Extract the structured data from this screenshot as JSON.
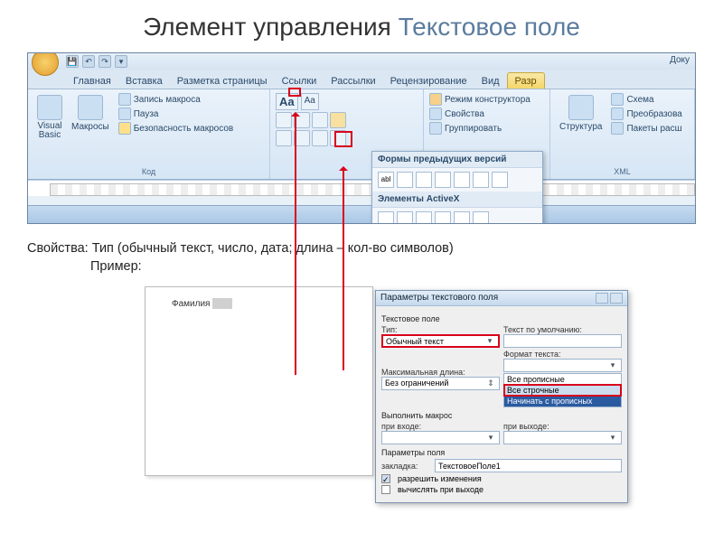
{
  "slide": {
    "title_plain": "Элемент управления ",
    "title_accent": "Текстовое поле"
  },
  "word": {
    "right_title": "Доку",
    "tabs": [
      "Главная",
      "Вставка",
      "Разметка страницы",
      "Ссылки",
      "Рассылки",
      "Рецензирование",
      "Вид",
      "Разр"
    ],
    "active_tab_index": 7,
    "groups": {
      "code": {
        "vb": "Visual\nBasic",
        "macros": "Макросы",
        "record": "Запись макроса",
        "pause": "Пауза",
        "security": "Безопасность макросов",
        "label": "Код"
      },
      "controls": {
        "aa_big": "Aa",
        "aa_small": "Aa",
        "design_mode": "Режим конструктора",
        "properties": "Свойства",
        "group": "Группировать"
      },
      "structure": {
        "btn": "Структура",
        "schema": "Схема",
        "transform": "Преобразова",
        "packages": "Пакеты расш",
        "label": "XML"
      }
    },
    "dropdown": {
      "hdr1": "Формы предыдущих версий",
      "items1": [
        "abl",
        "✓",
        "▭",
        "▦",
        "a̲",
        "◧",
        "▢"
      ],
      "hdr2": "Элементы ActiveX"
    }
  },
  "body": {
    "line1": "Свойства: Тип (обычный текст, число, дата; длина – кол-во символов)",
    "line2": "Пример:"
  },
  "doc": {
    "field_label": "Фамилия"
  },
  "dialog": {
    "title": "Параметры текстового поля",
    "section_field": "Текстовое поле",
    "type_label": "Тип:",
    "type_value": "Обычный текст",
    "default_label": "Текст по умолчанию:",
    "default_value": "",
    "maxlen_label": "Максимальная длина:",
    "maxlen_value": "Без ограничений",
    "format_label": "Формат текста:",
    "format_options": [
      "",
      "Все прописные",
      "Все строчные",
      "Начинать с прописных"
    ],
    "format_selected": "Начинать с прописных",
    "section_macro": "Выполнить макрос",
    "on_enter": "при входе:",
    "on_exit": "при выходе:",
    "section_params": "Параметры поля",
    "bookmark_label": "закладка:",
    "bookmark_value": "ТекстовоеПоле1",
    "allow_edit": "разрешить изменения",
    "calc_exit": "вычислять при выходе"
  }
}
